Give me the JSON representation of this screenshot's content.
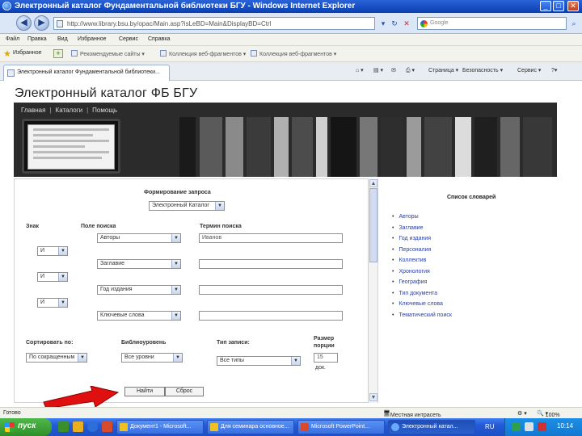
{
  "window": {
    "title": "Электронный каталог Фундаментальной библиотеки БГУ - Windows Internet Explorer",
    "min_label": "_",
    "max_label": "□",
    "close_label": "✕"
  },
  "address": {
    "back_label": "◀",
    "forward_label": "▶",
    "url": "http://www.library.bsu.by/opac/Main.asp?isLeBD=Main&DisplayBD=Ctrl",
    "search_placeholder": "Google",
    "go_label": "▾",
    "refresh_label": "↻",
    "stop_label": "✕",
    "search_go_label": "⌕"
  },
  "menu": [
    "Файл",
    "Правка",
    "Вид",
    "Избранное",
    "Сервис",
    "Справка"
  ],
  "favorites": {
    "label": "Избранное",
    "links": [
      "Рекомендуемые сайты ▾",
      "Коллекция веб-фрагментов ▾",
      "Коллекция веб-фрагментов ▾"
    ]
  },
  "tab": {
    "title": "Электронный каталог Фундаментальной библиотеки..."
  },
  "commands": [
    "Страница ▾",
    "Безопасность ▾",
    "Сервис ▾",
    "?▾"
  ],
  "page": {
    "site_title": "Электронный каталог ФБ БГУ",
    "nav": [
      "Главная",
      "Каталоги",
      "Помощь"
    ],
    "nav_separator": "|"
  },
  "form": {
    "heading": "Формирование запроса",
    "database": "Электронный Каталог",
    "col_operator": "Знак",
    "col_field": "Поле поиска",
    "col_term": "Термин поиска",
    "rows": [
      {
        "field": "Авторы",
        "term": "Иванов"
      },
      {
        "operator": "И",
        "field": "Заглавие",
        "term": ""
      },
      {
        "operator": "И",
        "field": "Год издания",
        "term": ""
      },
      {
        "operator": "И",
        "field": "Ключевые слова",
        "term": ""
      }
    ],
    "sort_label": "Сортировать по:",
    "sort_value": "По сокращенным",
    "biblevel_label": "Библиоуровень",
    "biblevel_value": "Все уровни",
    "type_label": "Тип записи:",
    "type_value": "Все типы",
    "portion_label_1": "Размер",
    "portion_label_2": "порции",
    "portion_value": "15",
    "portion_unit": "док.",
    "find_button": "Найти",
    "reset_button": "Сброс"
  },
  "dictionaries": {
    "heading": "Список словарей",
    "items": [
      "Авторы",
      "Заглавие",
      "Год издания",
      "Персоналия",
      "Коллектив",
      "Хронология",
      "География",
      "Тип документа",
      "Ключевые слова",
      "Тематический поиск"
    ]
  },
  "status": {
    "left": "Готово",
    "zone": "Местная интрасеть",
    "zoom": "100%"
  },
  "taskbar": {
    "start": "пуск",
    "tasks": [
      {
        "label": "Документ1 - Microsoft...",
        "active": false
      },
      {
        "label": "Для семинара основное...",
        "active": false
      },
      {
        "label": "Microsoft PowerPoint...",
        "active": false
      },
      {
        "label": "Электронный катал...",
        "active": true
      }
    ],
    "lang": "RU",
    "time": "10:14"
  },
  "colors": {
    "title_bar": "#0a3fb0",
    "link_blue": "#2a3fa8",
    "arrow_red": "#e01010",
    "banner_dark": "#2b2b2b",
    "taskbar_blue": "#235ad6",
    "start_green": "#2f8f2a"
  }
}
